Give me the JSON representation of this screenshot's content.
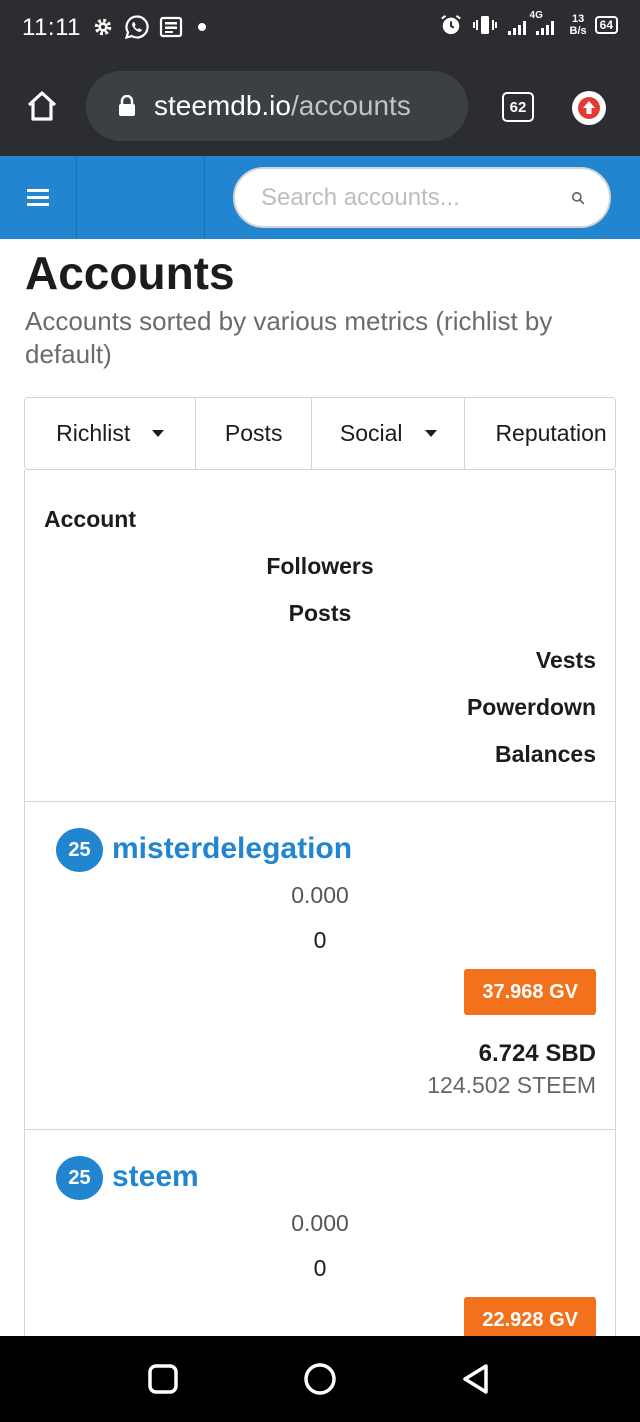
{
  "status_bar": {
    "time": "11:11",
    "network": "4G",
    "speed_value": "13",
    "speed_unit": "B/s",
    "battery": "64",
    "left_icons": [
      "gear-icon",
      "whatsapp-icon",
      "news-icon"
    ],
    "right_icons": [
      "alarm-icon",
      "vibrate-icon",
      "signal-icon"
    ]
  },
  "browser": {
    "url_domain": "steemdb.io",
    "url_path": "/accounts",
    "tab_count": "62"
  },
  "header": {
    "search_placeholder": "Search accounts..."
  },
  "page": {
    "title": "Accounts",
    "subtitle": "Accounts sorted by various metrics (richlist by default)"
  },
  "menu": {
    "items": [
      {
        "label": "Richlist",
        "dropdown": true
      },
      {
        "label": "Posts",
        "dropdown": false
      },
      {
        "label": "Social",
        "dropdown": true
      },
      {
        "label": "Reputation",
        "dropdown": false
      }
    ]
  },
  "table": {
    "headers": {
      "account": "Account",
      "followers": "Followers",
      "posts": "Posts",
      "vests": "Vests",
      "powerdown": "Powerdown",
      "balances": "Balances"
    },
    "rows": [
      {
        "reputation": "25",
        "name": "misterdelegation",
        "followers": "0.000",
        "posts": "0",
        "vests": "37.968 GV",
        "sbd": "6.724 SBD",
        "steem": "124.502 STEEM"
      },
      {
        "reputation": "25",
        "name": "steem",
        "followers": "0.000",
        "posts": "0",
        "vests": "22.928 GV"
      }
    ]
  },
  "colors": {
    "primary_blue": "#2185d0",
    "orange": "#f2711c",
    "chrome_dark": "#2b2d30"
  }
}
